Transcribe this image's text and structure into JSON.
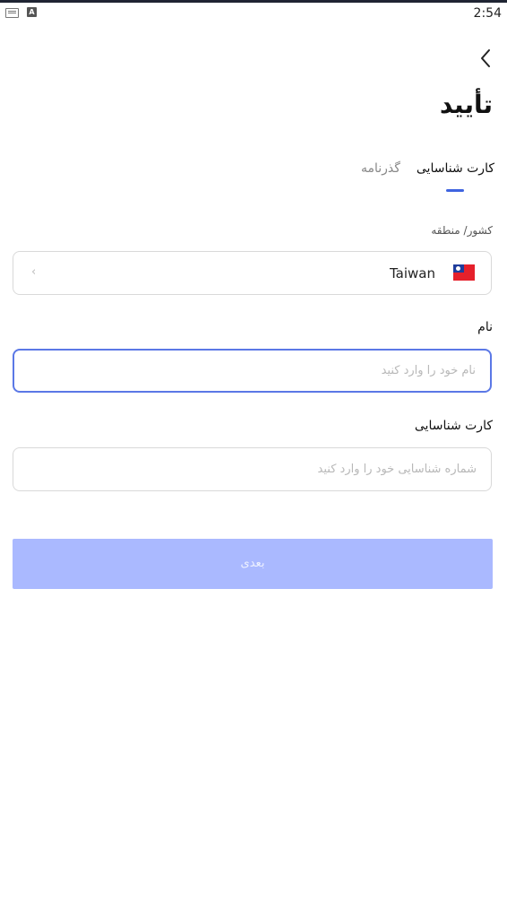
{
  "status_bar": {
    "time": "2:54",
    "notification_icon_letter": "A"
  },
  "header": {
    "back_icon": "chevron-left-icon",
    "title": "تأیید"
  },
  "tabs": [
    {
      "label": "کارت شناسایی",
      "active": true
    },
    {
      "label": "گذرنامه",
      "active": false
    }
  ],
  "form": {
    "country": {
      "label": "کشور/ منطقه",
      "value": "Taiwan",
      "flag_icon": "taiwan-flag-icon",
      "chevron_icon": "chevron-icon"
    },
    "name": {
      "label": "نام",
      "placeholder": "نام خود را وارد کنید"
    },
    "id_card": {
      "label": "کارت شناسایی",
      "placeholder": "شماره شناسایی خود را وارد کنید"
    },
    "next_label": "بعدی"
  },
  "colors": {
    "accent": "#3f64e0",
    "button_disabled": "#aab9ff",
    "focus_border": "#5b78e6"
  }
}
